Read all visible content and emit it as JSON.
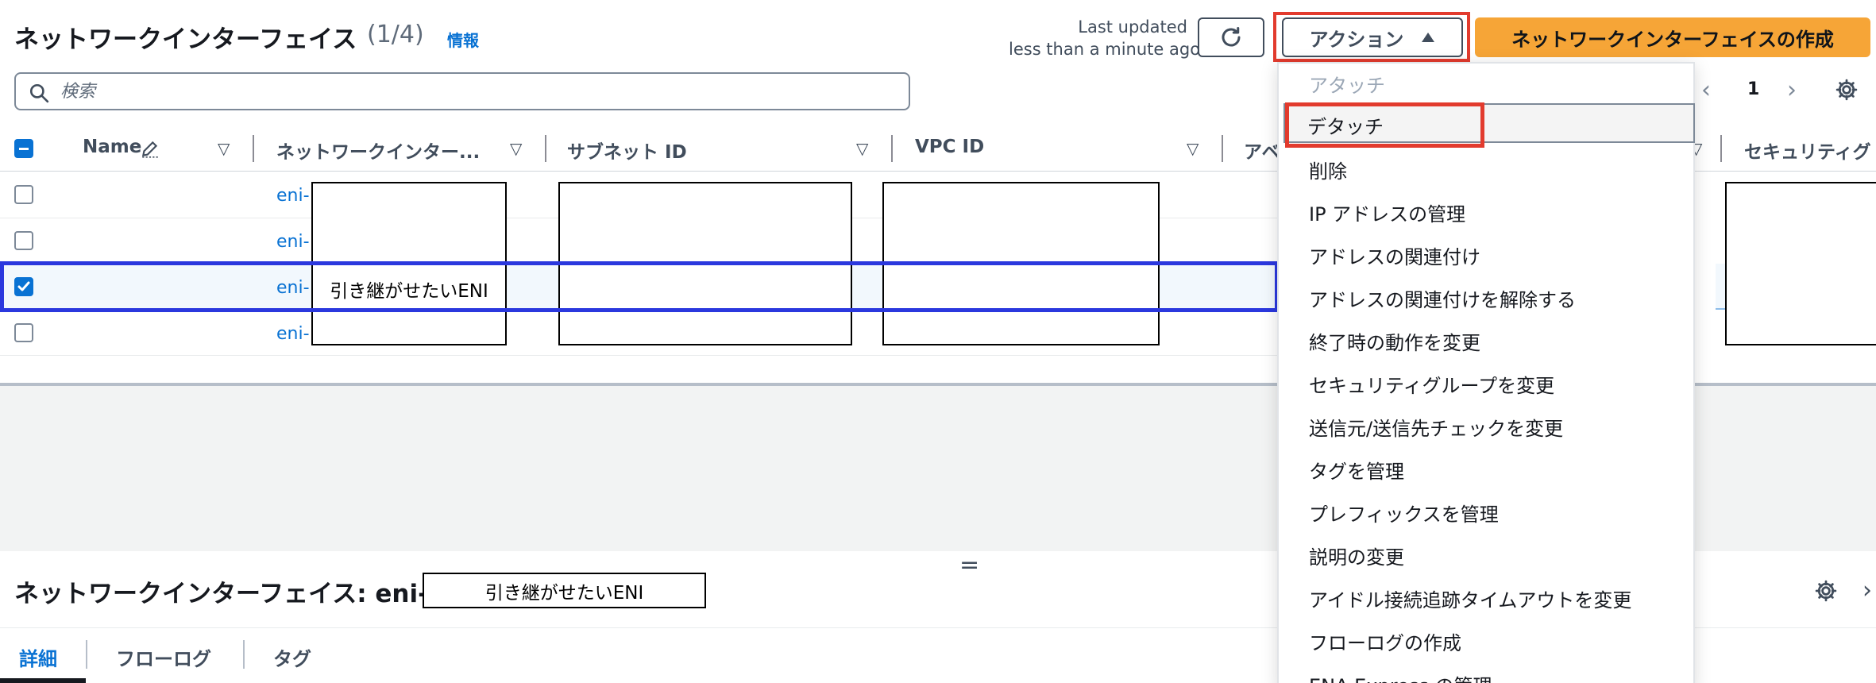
{
  "header": {
    "title": "ネットワークインターフェイス",
    "count": "(1/4)",
    "info_link": "情報",
    "last_updated_label": "Last updated",
    "last_updated_value": "less than a minute ago",
    "actions_label": "アクション",
    "create_label": "ネットワークインターフェイスの作成"
  },
  "search": {
    "placeholder": "検索"
  },
  "pagination": {
    "page": "1"
  },
  "table": {
    "columns": [
      {
        "label": "Name"
      },
      {
        "label": "ネットワークインター..."
      },
      {
        "label": "サブネット ID"
      },
      {
        "label": "VPC ID"
      },
      {
        "label": "アベ"
      },
      {
        "label": "セキュリティグ"
      }
    ],
    "rows": [
      {
        "eni": "eni-",
        "selected": false
      },
      {
        "eni": "eni-",
        "selected": false
      },
      {
        "eni": "eni-",
        "selected": true
      },
      {
        "eni": "eni-",
        "selected": false
      }
    ],
    "redaction_label": "引き継がせたいENI"
  },
  "dropdown": {
    "items": [
      {
        "label": "アタッチ",
        "disabled": true
      },
      {
        "label": "デタッチ",
        "disabled": false
      },
      {
        "label": "削除",
        "disabled": false
      },
      {
        "label": "IP アドレスの管理",
        "disabled": false
      },
      {
        "label": "アドレスの関連付け",
        "disabled": false
      },
      {
        "label": "アドレスの関連付けを解除する",
        "disabled": false
      },
      {
        "label": "終了時の動作を変更",
        "disabled": false
      },
      {
        "label": "セキュリティグループを変更",
        "disabled": false
      },
      {
        "label": "送信元/送信先チェックを変更",
        "disabled": false
      },
      {
        "label": "タグを管理",
        "disabled": false
      },
      {
        "label": "プレフィックスを管理",
        "disabled": false
      },
      {
        "label": "説明の変更",
        "disabled": false
      },
      {
        "label": "アイドル接続追跡タイムアウトを変更",
        "disabled": false
      },
      {
        "label": "フローログの作成",
        "disabled": false
      },
      {
        "label": "ENA Express の管理",
        "disabled": false
      }
    ]
  },
  "detail": {
    "title": "ネットワークインターフェイス: eni-",
    "redaction_label": "引き継がせたいENI",
    "tabs": [
      {
        "label": "詳細",
        "active": true
      },
      {
        "label": "フローログ",
        "active": false
      },
      {
        "label": "タグ",
        "active": false
      }
    ]
  },
  "colors": {
    "highlight_red": "#e23b2e",
    "selection_blue": "#2b38de",
    "primary_orange": "#f6a537",
    "link_blue": "#0972d3"
  }
}
